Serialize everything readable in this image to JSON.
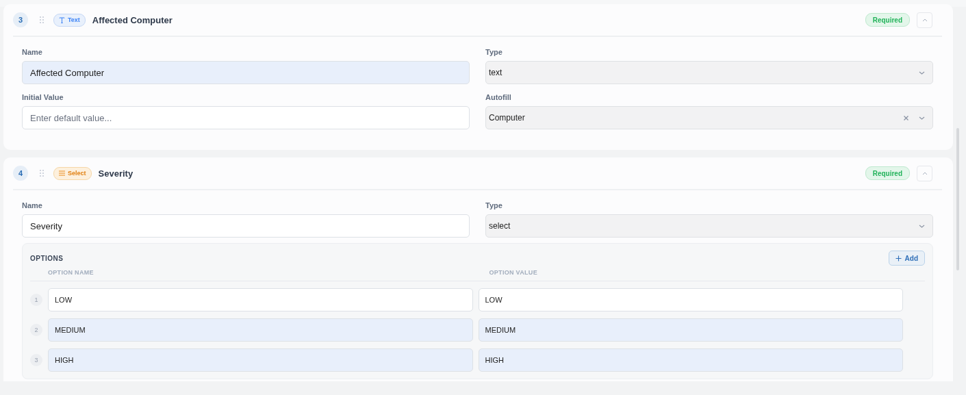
{
  "cards": [
    {
      "number": "3",
      "badge": {
        "kind": "text",
        "label": "Text"
      },
      "title": "Affected Computer",
      "required_label": "Required",
      "expanded": true,
      "fields": [
        {
          "label": "Name",
          "kind": "input",
          "value": "Affected Computer",
          "highlighted": true
        },
        {
          "label": "Type",
          "kind": "dropdown",
          "value": "text",
          "clearable": false
        },
        {
          "label": "Initial Value",
          "kind": "input",
          "placeholder": "Enter default value...",
          "highlighted": false
        },
        {
          "label": "Autofill",
          "kind": "dropdown",
          "value": "Computer",
          "clearable": true
        }
      ]
    },
    {
      "number": "4",
      "badge": {
        "kind": "select",
        "label": "Select"
      },
      "title": "Severity",
      "required_label": "Required",
      "expanded": true,
      "fields": [
        {
          "label": "Name",
          "kind": "input",
          "value": "Severity",
          "highlighted": false
        },
        {
          "label": "Type",
          "kind": "dropdown",
          "value": "select",
          "clearable": false
        }
      ],
      "options": {
        "title": "OPTIONS",
        "add_label": "Add",
        "columns": [
          "OPTION NAME",
          "OPTION VALUE"
        ],
        "rows": [
          {
            "number": "1",
            "name": "LOW",
            "value": "LOW",
            "highlighted": false
          },
          {
            "number": "2",
            "name": "MEDIUM",
            "value": "MEDIUM",
            "highlighted": true
          },
          {
            "number": "3",
            "name": "HIGH",
            "value": "HIGH",
            "highlighted": true
          }
        ]
      }
    }
  ]
}
